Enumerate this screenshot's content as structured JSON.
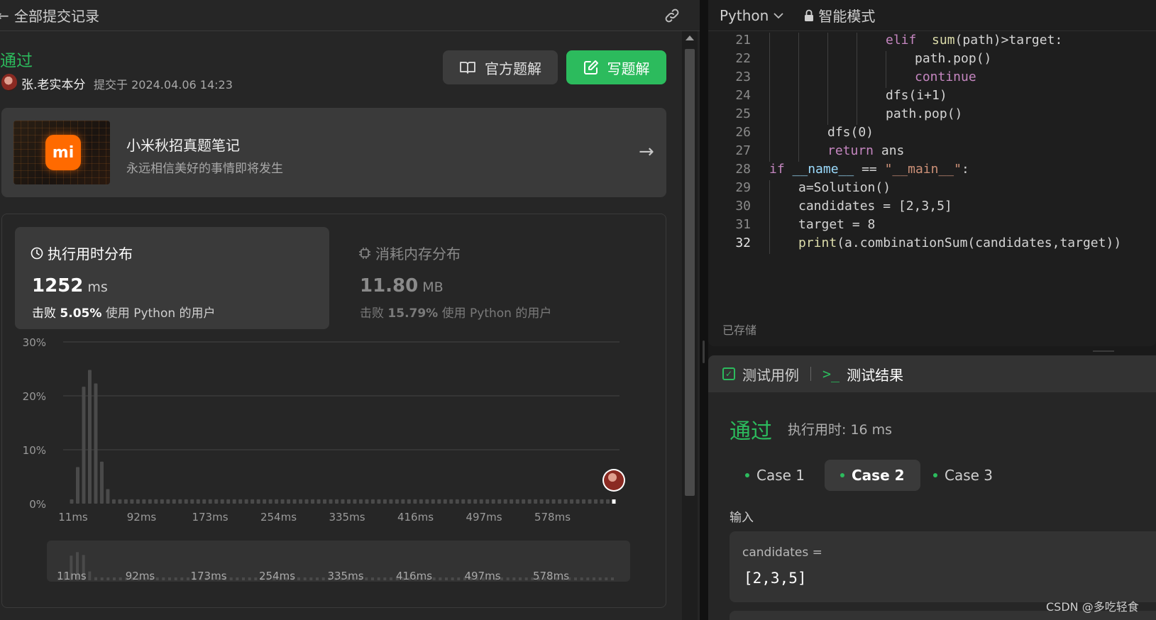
{
  "header": {
    "back_icon": "arrow-left-icon",
    "title": "全部提交记录",
    "link_icon": "link-icon"
  },
  "submission": {
    "status": "通过",
    "author": "张.老实本分",
    "submitted_at": "提交于 2024.04.06 14:23"
  },
  "actions": {
    "official_label": "官方题解",
    "write_label": "写题解"
  },
  "promo": {
    "logo_text": "mi",
    "title": "小米秋招真题笔记",
    "subtitle": "永远相信美好的事情即将发生"
  },
  "runtime": {
    "label": "执行用时分布",
    "value": "1252",
    "unit": "ms",
    "beat_prefix": "击败",
    "beat_pct": "5.05%",
    "beat_suffix": "使用 Python 的用户"
  },
  "memory": {
    "label": "消耗内存分布",
    "value": "11.80",
    "unit": "MB",
    "beat_prefix": "击败",
    "beat_pct": "15.79%",
    "beat_suffix": "使用 Python 的用户"
  },
  "chart_data": {
    "type": "bar",
    "ylabels": [
      "30%",
      "20%",
      "10%",
      "0%"
    ],
    "ylim": [
      0,
      30
    ],
    "xlabels": [
      "11ms",
      "92ms",
      "173ms",
      "254ms",
      "335ms",
      "416ms",
      "497ms",
      "578ms"
    ],
    "values": [
      0.8,
      6.8,
      21.7,
      24.8,
      22.3,
      7.8,
      2.7,
      0.8,
      0.8,
      0.8,
      0.8,
      0.8,
      0.8,
      0.8,
      0.8,
      0.8,
      0.8,
      0.8,
      0.8,
      0.8,
      0.8,
      0.8,
      0.8,
      0.8,
      0.8,
      0.8,
      0.8,
      0.8,
      0.8,
      0.8,
      0.8,
      0.8,
      0.8,
      0.8,
      0.8,
      0.8,
      0.8,
      0.8,
      0.8,
      0.8,
      0.8,
      0.8,
      0.8,
      0.8,
      0.8,
      0.8,
      0.8,
      0.8,
      0.8,
      0.8,
      0.8,
      0.8,
      0.8,
      0.8,
      0.8,
      0.8,
      0.8,
      0.8,
      0.8,
      0.8,
      0.8,
      0.8,
      0.8,
      0.8,
      0.8,
      0.8,
      0.8,
      0.8,
      0.8,
      0.8,
      0.8,
      0.8,
      0.8,
      0.8,
      0.8,
      0.8,
      0.8,
      0.8,
      0.8,
      0.8,
      0.8,
      0.8,
      0.8,
      0.8,
      0.8,
      0.8,
      0.8,
      0.8,
      0.8,
      0.8,
      0.8
    ],
    "grid": true,
    "marker": "user-avatar at last bar",
    "colors": {
      "bar": "#4a4a4a",
      "grid": "#444444"
    }
  },
  "editor": {
    "language": "Python",
    "mode": "智能模式",
    "saved": "已存储",
    "lines": [
      {
        "n": "21",
        "indent": 4,
        "tokens": [
          [
            "kw",
            "elif"
          ],
          [
            "",
            "  "
          ],
          [
            "fn",
            "sum"
          ],
          [
            "",
            "(path)>target:"
          ]
        ]
      },
      {
        "n": "22",
        "indent": 5,
        "tokens": [
          [
            "",
            "path.pop()"
          ]
        ]
      },
      {
        "n": "23",
        "indent": 5,
        "tokens": [
          [
            "kw",
            "continue"
          ]
        ]
      },
      {
        "n": "24",
        "indent": 4,
        "tokens": [
          [
            "",
            "dfs(i+1)"
          ]
        ]
      },
      {
        "n": "25",
        "indent": 4,
        "tokens": [
          [
            "",
            "path.pop()"
          ]
        ]
      },
      {
        "n": "26",
        "indent": 2,
        "tokens": [
          [
            "",
            "dfs(0)"
          ]
        ]
      },
      {
        "n": "27",
        "indent": 2,
        "tokens": [
          [
            "kw",
            "return"
          ],
          [
            "",
            " ans"
          ]
        ]
      },
      {
        "n": "28",
        "indent": 0,
        "tokens": [
          [
            "kw",
            "if"
          ],
          [
            "",
            " "
          ],
          [
            "var",
            "__name__"
          ],
          [
            "",
            " == "
          ],
          [
            "str",
            "\"__main__\""
          ],
          [
            "",
            ":"
          ]
        ]
      },
      {
        "n": "29",
        "indent": 1,
        "tokens": [
          [
            "",
            "a=Solution()"
          ]
        ]
      },
      {
        "n": "30",
        "indent": 1,
        "tokens": [
          [
            "",
            "candidates = [2,3,5]"
          ]
        ]
      },
      {
        "n": "31",
        "indent": 1,
        "tokens": [
          [
            "",
            "target = 8"
          ]
        ]
      },
      {
        "n": "32",
        "indent": 1,
        "tokens": [
          [
            "fn",
            "print"
          ],
          [
            "",
            "(a.combinationSum(candidates,target))"
          ]
        ]
      }
    ]
  },
  "tests": {
    "tab_cases": "测试用例",
    "tab_result_icon": ">_",
    "tab_result": "测试结果",
    "status": "通过",
    "runtime": "执行用时: 16 ms",
    "cases": [
      "Case 1",
      "Case 2",
      "Case 3"
    ],
    "input_label": "输入",
    "input_name": "candidates =",
    "input_value": "[2,3,5]"
  },
  "watermark": "CSDN @多吃轻食"
}
